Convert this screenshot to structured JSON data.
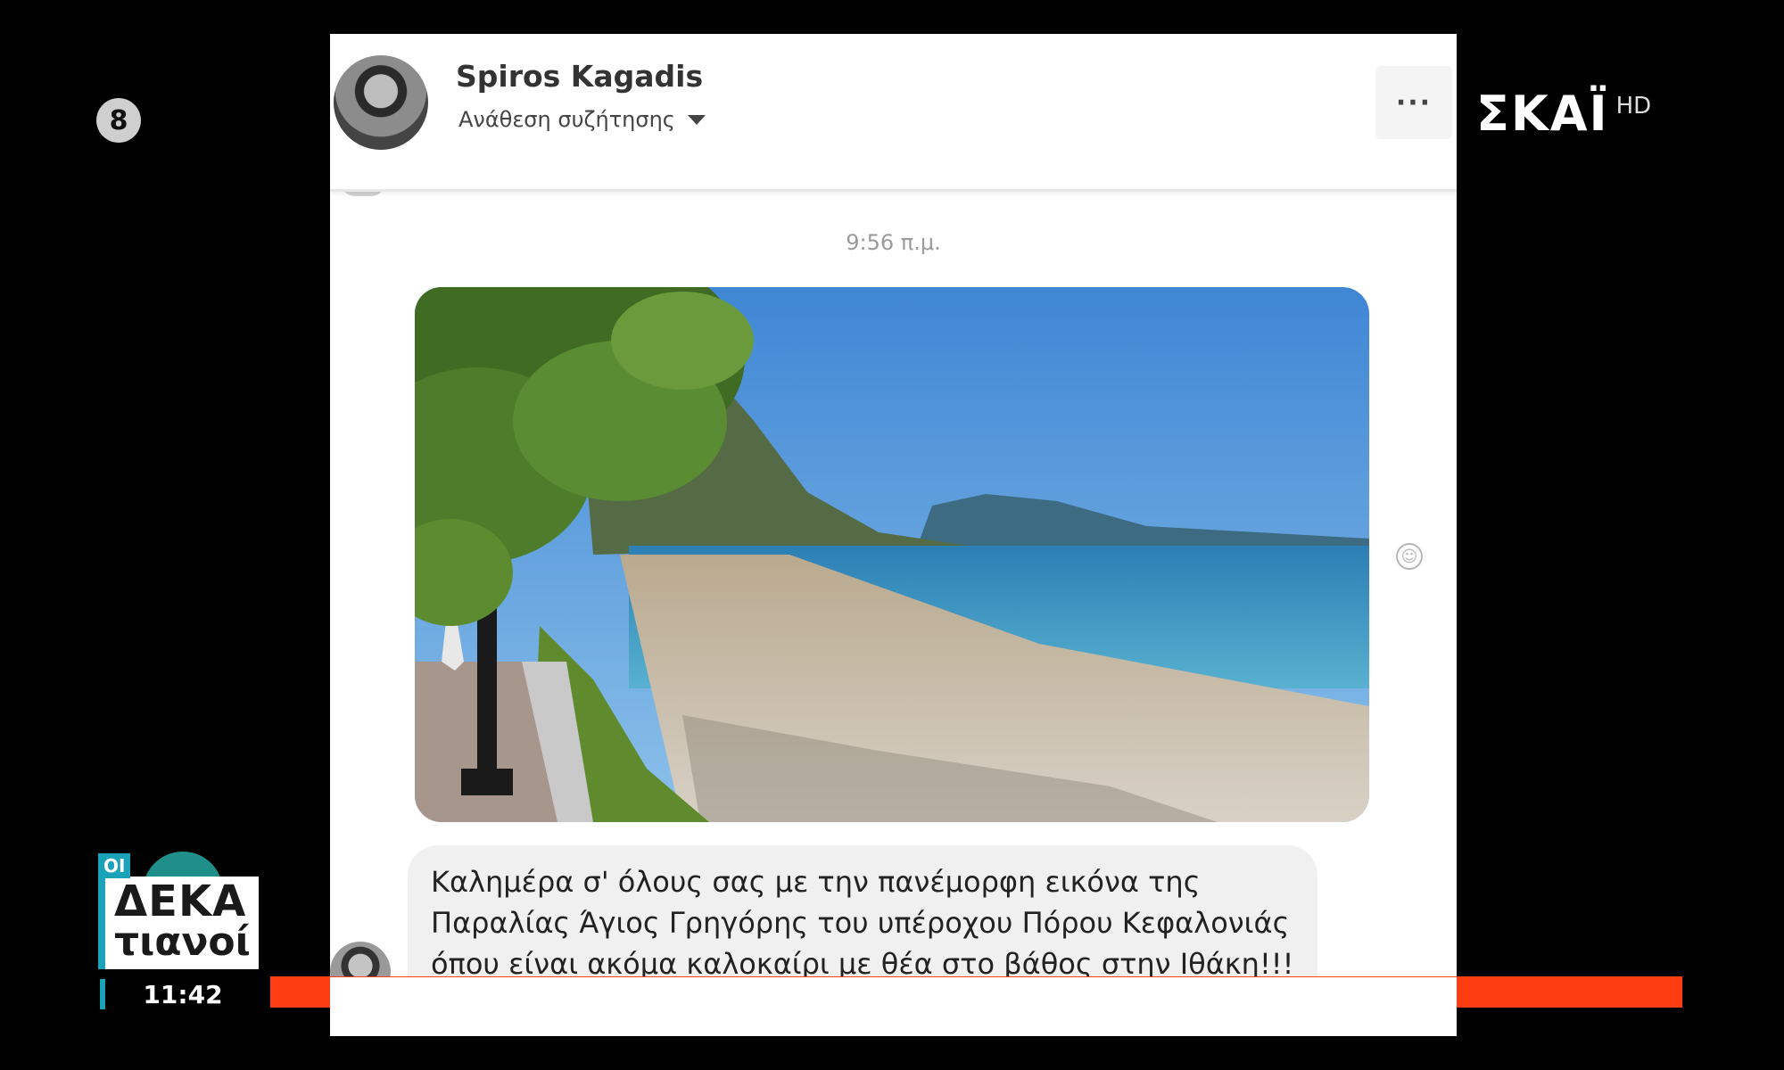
{
  "overlay": {
    "rating": "8",
    "channel_name": "ΣΚΑΪ",
    "channel_hd": "HD",
    "show_logo": {
      "small": "ΟΙ",
      "line1": "ΔΕΚΑ",
      "line2": "τιανοί"
    },
    "clock": "11:42",
    "ticker_color": "#ff3d12"
  },
  "conversation": {
    "contact_name": "Spiros Kagadis",
    "contact_subtitle": "Ανάθεση συζήτησης",
    "more_label": "···",
    "timestamp": "9:56 π.μ.",
    "photo_icon": "beach-photo",
    "message": {
      "line1": "Καλημέρα σ' όλους σας με την πανέμορφη εικόνα της",
      "line2": "Παραλίας Άγιος Γρηγόρης του υπέροχου Πόρου Κεφαλονιάς",
      "line3": "όπου είναι ακόμα καλοκαίρι με θέα στο βάθος στην Ιθάκη!!!"
    }
  }
}
